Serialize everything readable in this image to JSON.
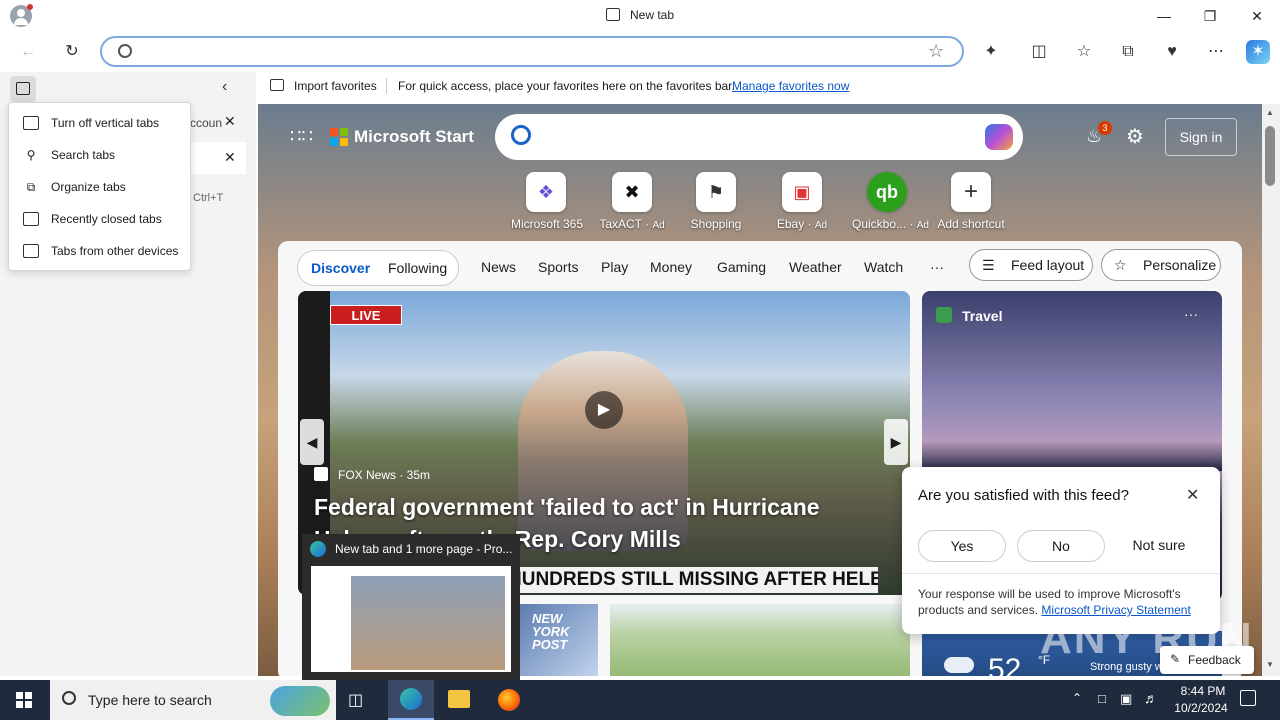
{
  "window": {
    "title": "New tab",
    "controls": [
      "minimize",
      "restore",
      "close"
    ]
  },
  "toolbar": {
    "back_icon": "back-arrow-icon",
    "refresh_icon": "refresh-icon",
    "address_value": "",
    "right_icons": [
      "extensions-icon",
      "split-screen-icon",
      "favorites-icon",
      "collections-icon",
      "browser-essentials-icon",
      "more-icon",
      "copilot-icon"
    ]
  },
  "favbar": {
    "import_label": "Import favorites",
    "message": "For quick access, place your favorites here on the favorites bar.",
    "manage_link": "Manage favorites now"
  },
  "vertical_tabs": {
    "tab_partial_text": "ccoun",
    "shortcut": "Ctrl+T",
    "menu": [
      {
        "label": "Turn off vertical tabs",
        "icon": "vertical-tabs-icon"
      },
      {
        "label": "Search tabs",
        "icon": "search-icon"
      },
      {
        "label": "Organize tabs",
        "icon": "organize-tabs-icon"
      },
      {
        "label": "Recently closed tabs",
        "icon": "history-icon"
      },
      {
        "label": "Tabs from other devices",
        "icon": "devices-icon"
      }
    ]
  },
  "msn": {
    "brand": "Microsoft Start",
    "notification_count": "3",
    "sign_in": "Sign in",
    "shortcuts": [
      {
        "label": "Microsoft 365",
        "ad": ""
      },
      {
        "label": "TaxACT",
        "ad": "Ad"
      },
      {
        "label": "Shopping",
        "ad": ""
      },
      {
        "label": "Ebay",
        "ad": "Ad"
      },
      {
        "label": "Quickbo...",
        "ad": "Ad"
      },
      {
        "label": "Add shortcut",
        "ad": ""
      }
    ],
    "tabs": [
      "Discover",
      "Following"
    ],
    "nav": [
      "News",
      "Sports",
      "Play",
      "Money",
      "Gaming",
      "Weather",
      "Watch"
    ],
    "more": "···",
    "feed_layout": "Feed layout",
    "personalize": "Personalize",
    "hero": {
      "live": "LIVE",
      "source": "FOX News · 35m",
      "headline": "Federal government 'failed to act' in Hurricane Helene aftermath: Rep. Cory Mills",
      "chyron": "HUNDREDS STILL MISSING AFTER HELENE"
    },
    "travel": {
      "label": "Travel",
      "more": "···"
    },
    "bottom_card_text": "NEW YORK POST",
    "weather_temp": "52",
    "weather_unit": "°F",
    "weather_desc": "Strong gusty winds",
    "feedback": "Feedback"
  },
  "survey": {
    "question": "Are you satisfied with this feed?",
    "options": [
      "Yes",
      "No",
      "Not sure"
    ],
    "note": "Your response will be used to improve Microsoft's products and services.",
    "privacy_link": "Microsoft Privacy Statement"
  },
  "thumbnail": {
    "title": "New tab and 1 more page - Pro..."
  },
  "watermark": "ANY RUN",
  "taskbar": {
    "search_placeholder": "Type here to search",
    "time": "8:44 PM",
    "date": "10/2/2024"
  }
}
